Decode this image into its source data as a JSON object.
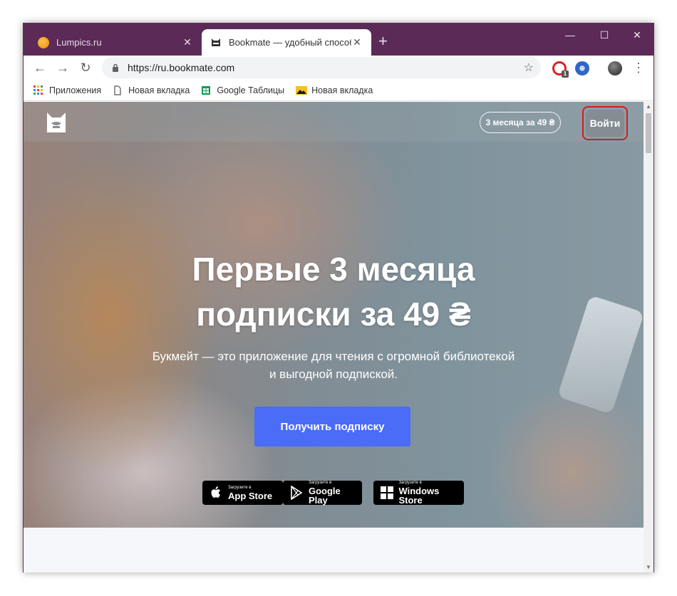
{
  "tabs": [
    {
      "title": "Lumpics.ru",
      "favicon": "orange-circle-icon"
    },
    {
      "title": "Bookmate — удобный способ ч",
      "favicon": "bookmate-cat-icon"
    }
  ],
  "toolbar": {
    "url": "https://ru.bookmate.com",
    "extension_badge": "1"
  },
  "bookmarks": [
    {
      "label": "Приложения",
      "icon": "apps-grid-icon"
    },
    {
      "label": "Новая вкладка",
      "icon": "page-icon"
    },
    {
      "label": "Google Таблицы",
      "icon": "sheets-icon"
    },
    {
      "label": "Новая вкладка",
      "icon": "image-icon"
    }
  ],
  "page": {
    "promo_pill": "3 месяца за 49 ₴",
    "login": "Войти",
    "headline_line1": "Первые 3 месяца",
    "headline_line2": "подписки за 49 ₴",
    "subline_line1": "Букмейт — это приложение для чтения с огромной библиотекой",
    "subline_line2": "и выгодной подпиской.",
    "cta": "Получить подписку",
    "stores": [
      {
        "small": "Загрузите в",
        "big": "App Store",
        "icon": "apple-icon"
      },
      {
        "small": "Загрузите в",
        "big": "Google Play",
        "icon": "google-play-icon"
      },
      {
        "small": "Загрузите в",
        "big": "Windows Store",
        "icon": "windows-icon"
      }
    ]
  },
  "colors": {
    "titlebar": "#5b2a57",
    "cta": "#4a6cf7",
    "login_highlight": "#cc1f1f"
  }
}
